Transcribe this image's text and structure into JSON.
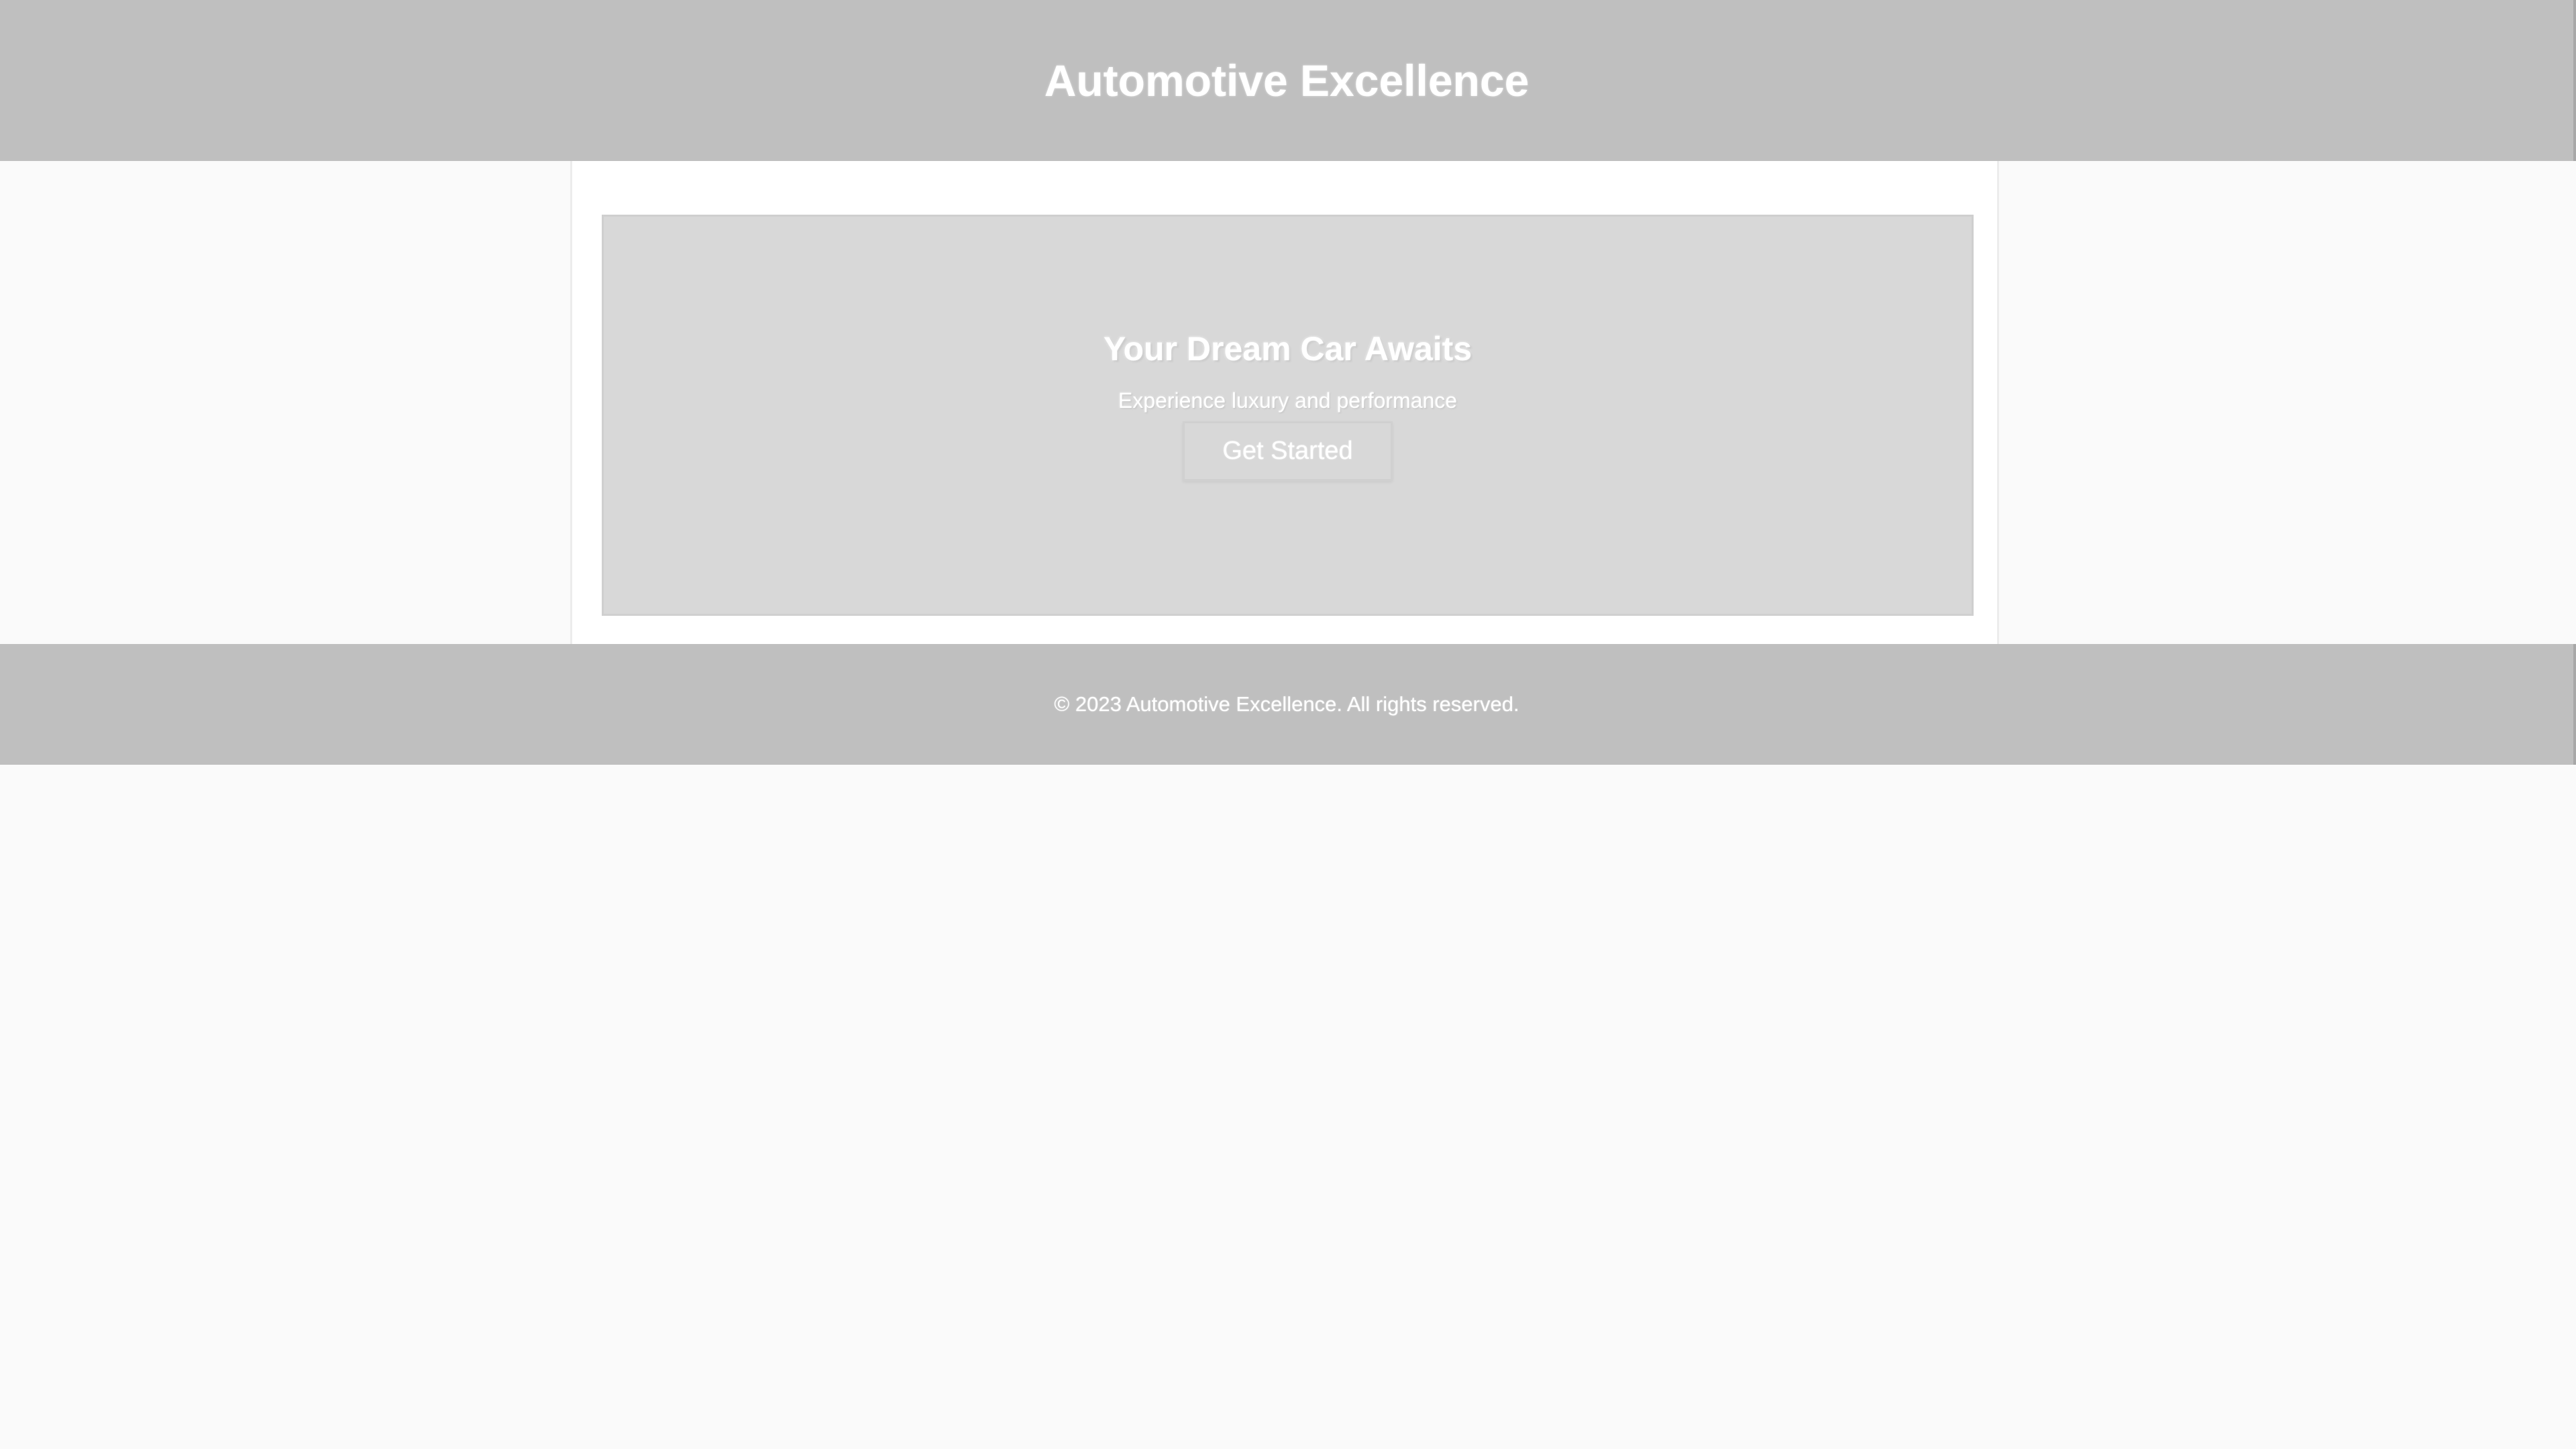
{
  "header": {
    "title": "Automotive Excellence"
  },
  "hero": {
    "heading": "Your Dream Car Awaits",
    "subtext": "Experience luxury and performance",
    "cta_label": "Get Started"
  },
  "footer": {
    "copyright": "© 2023 Automotive Excellence. All rights reserved."
  },
  "colors": {
    "header_bg": "#bfbfbf",
    "page_bg": "#fafafa",
    "hero_bg": "#d8d8d8",
    "text": "#ffffff"
  }
}
